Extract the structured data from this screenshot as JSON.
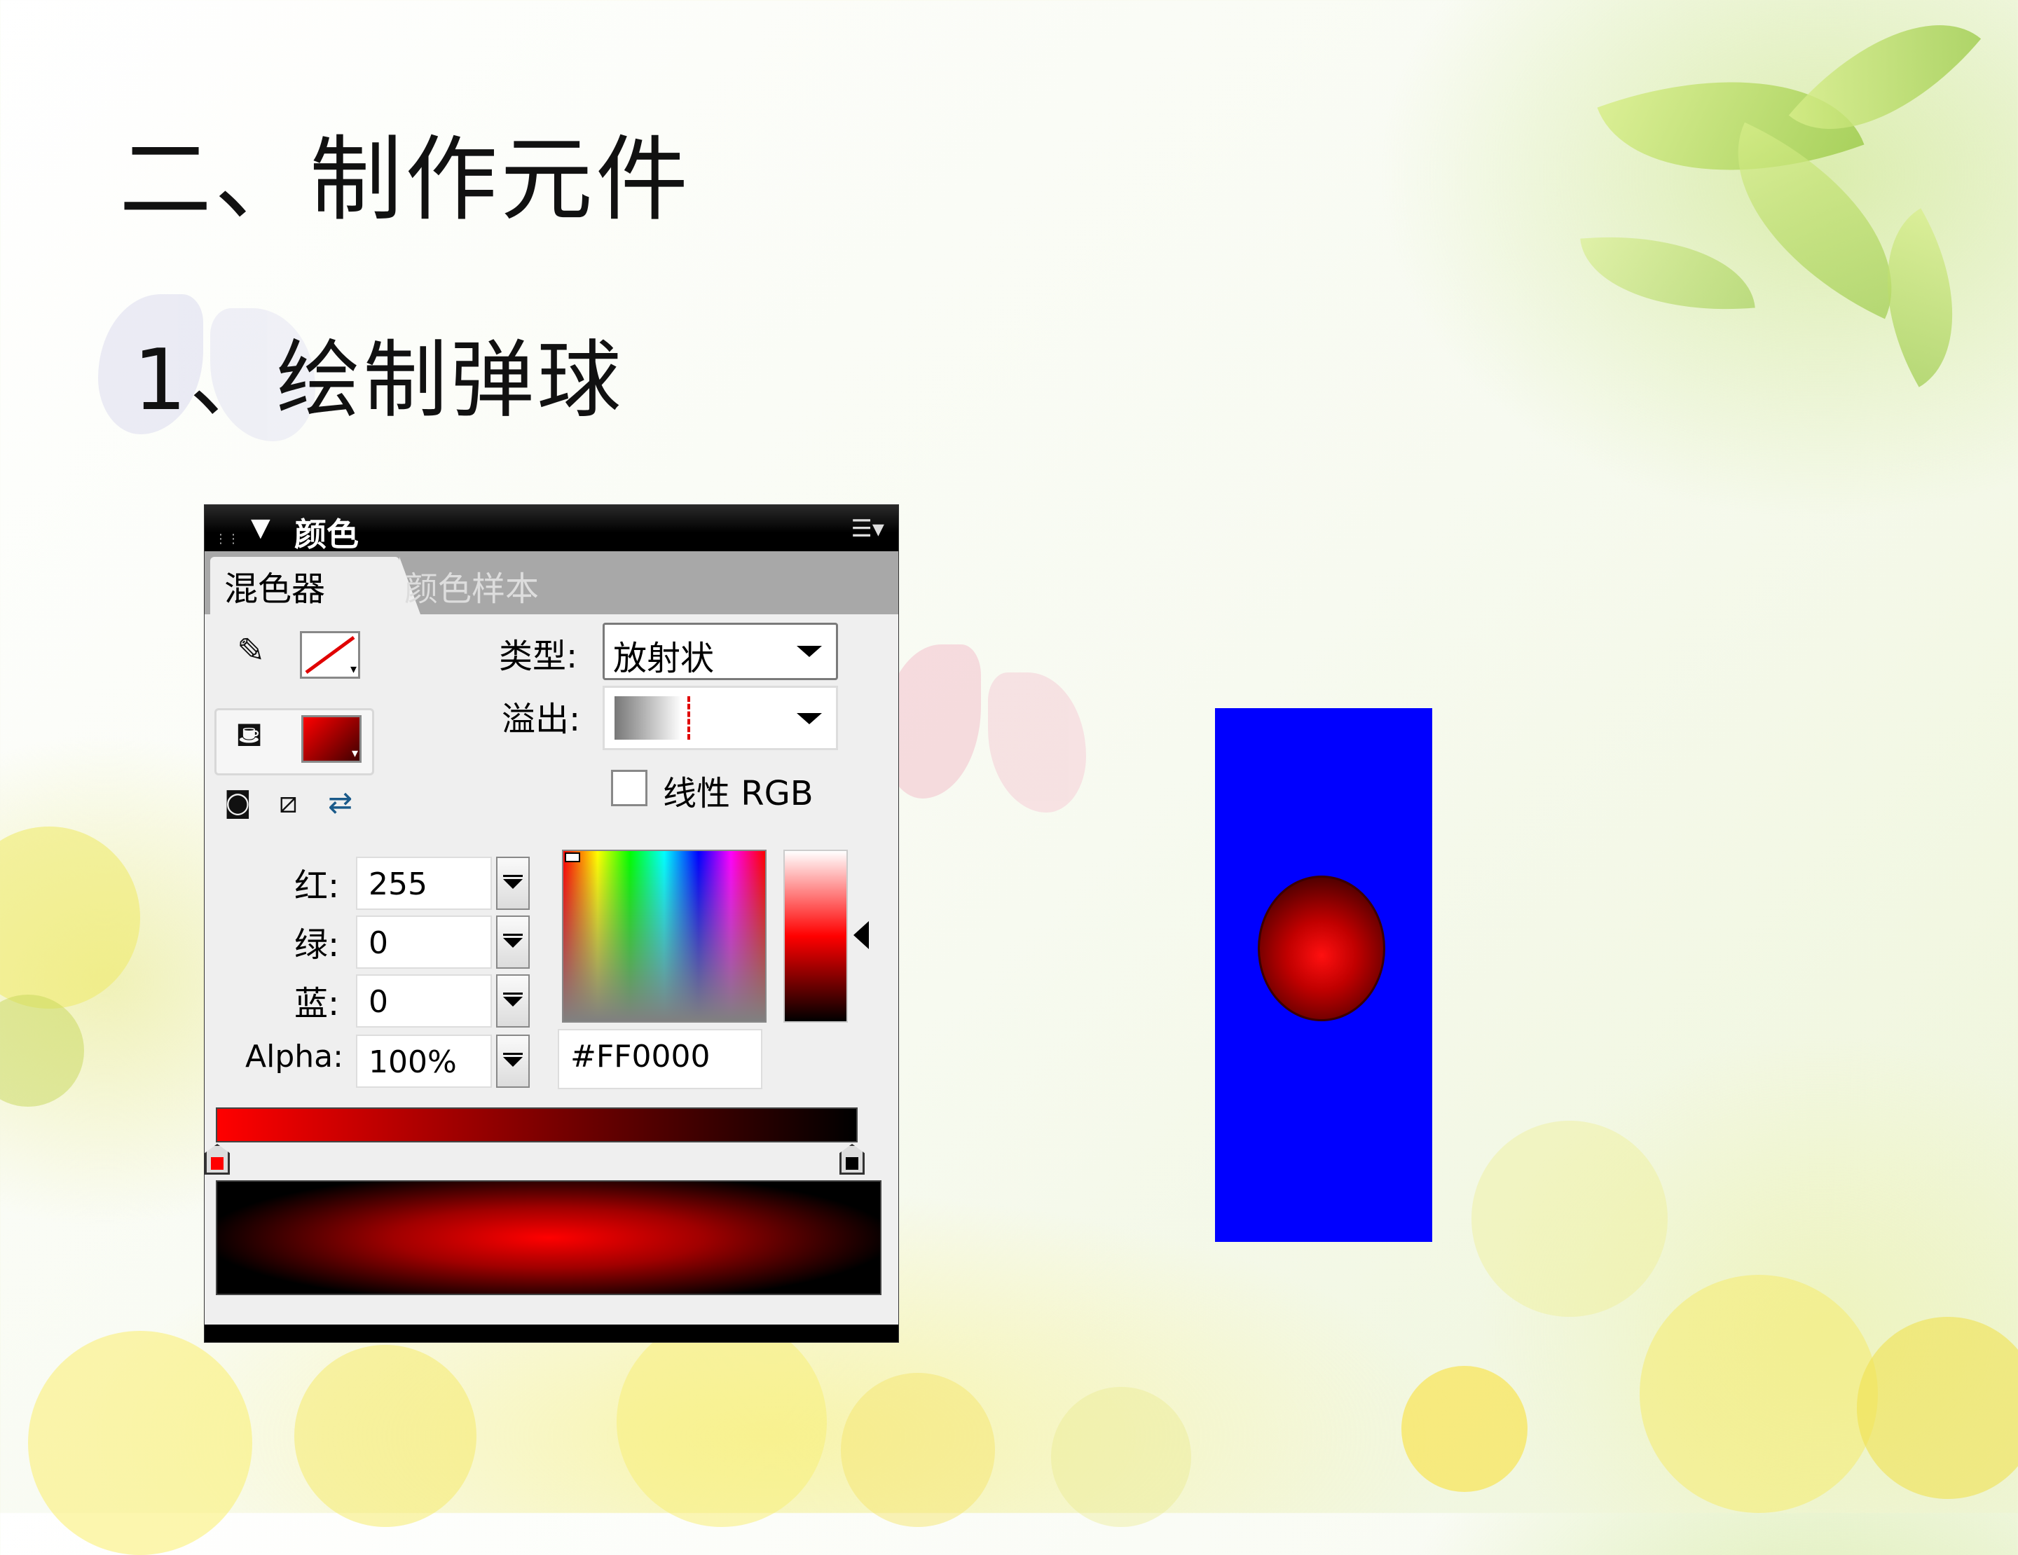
{
  "slide": {
    "title": "二、制作元件",
    "subtitle": "1、绘制弹球"
  },
  "color_panel": {
    "title": "颜色",
    "tabs": [
      {
        "label": "混色器",
        "active": true
      },
      {
        "label": "颜色样本",
        "active": false
      }
    ],
    "stroke_icon": "pencil-icon",
    "fill_icon": "paint-bucket-icon",
    "type_label": "类型:",
    "type_value": "放射状",
    "overflow_label": "溢出:",
    "linear_rgb_label": "线性 RGB",
    "linear_rgb_checked": false,
    "red_label": "红:",
    "red_value": "255",
    "green_label": "绿:",
    "green_value": "0",
    "blue_label": "蓝:",
    "blue_value": "0",
    "alpha_label": "Alpha:",
    "alpha_value": "100%",
    "hex_value": "#FF0000",
    "gradient_stops": [
      "#FF0000",
      "#000000"
    ]
  },
  "colors": {
    "stage_bg": "#0000FF",
    "ball_center": "#FF0000",
    "ball_edge": "#000000"
  }
}
